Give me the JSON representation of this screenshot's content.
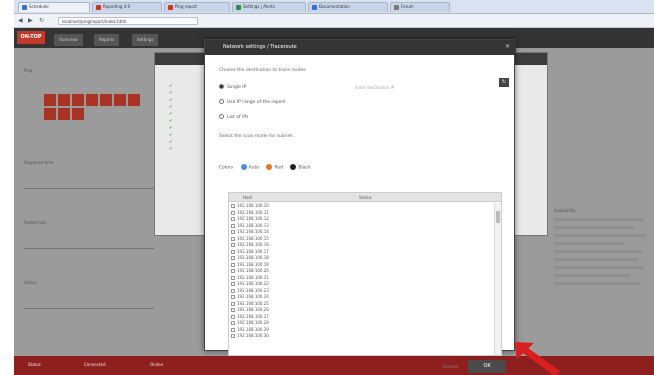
{
  "browser": {
    "tabs": [
      {
        "label": "Scheduler",
        "active": true,
        "favicon": "#3b6bd6"
      },
      {
        "label": "Reporting 4.9",
        "active": false,
        "favicon": "#c0392b"
      },
      {
        "label": "Ping report",
        "active": false,
        "favicon": "#c0392b"
      },
      {
        "label": "Settings | Alerts",
        "active": false,
        "favicon": "#2e8b57"
      },
      {
        "label": "Documentation",
        "active": false,
        "favicon": "#3b6bd6"
      },
      {
        "label": "Forum",
        "active": false,
        "favicon": "#777777"
      }
    ],
    "url": "localhost/ping/report/index.html"
  },
  "app": {
    "brand": "ON-TOP",
    "header_tabs": [
      "Overview",
      "Reports",
      "Settings"
    ],
    "background_labels": [
      "Ping",
      "Response time",
      "Packet loss",
      "Status",
      "Availability"
    ],
    "footer": {
      "items": [
        "Status",
        "Connected",
        "Online"
      ]
    }
  },
  "modal": {
    "title": "Network settings / Traceroute",
    "scope_label": "Choose the destination to trace routes",
    "options": [
      {
        "label": "Single IP",
        "selected": true
      },
      {
        "label": "Use IP range of the report",
        "selected": false
      },
      {
        "label": "List of IPs",
        "selected": false
      }
    ],
    "hint": "Enter destination IP",
    "subnet_label": "Select the scan mode for subnet",
    "colors_label": "Colors",
    "color_options": [
      {
        "label": "Auto",
        "color": "#4a90d9"
      },
      {
        "label": "Red",
        "color": "#e07b1f"
      },
      {
        "label": "Black",
        "color": "#222222"
      }
    ],
    "table": {
      "columns": [
        "Host",
        "Status"
      ],
      "rows": [
        "192.168.100.10",
        "192.168.100.11",
        "192.168.100.12",
        "192.168.100.13",
        "192.168.100.14",
        "192.168.100.15",
        "192.168.100.16",
        "192.168.100.17",
        "192.168.100.18",
        "192.168.100.19",
        "192.168.100.20",
        "192.168.100.21",
        "192.168.100.22",
        "192.168.100.23",
        "192.168.100.24",
        "192.168.100.25",
        "192.168.100.26",
        "192.168.100.27",
        "192.168.100.28",
        "192.168.100.29",
        "192.168.100.30"
      ]
    },
    "cancel_label": "Cancel",
    "ok_label": "OK",
    "close_glyph": "✕",
    "refresh_glyph": "↻"
  },
  "colors": {
    "accent": "#c0392b",
    "footer": "#8e1f1f",
    "arrow": "#d81e1e"
  }
}
